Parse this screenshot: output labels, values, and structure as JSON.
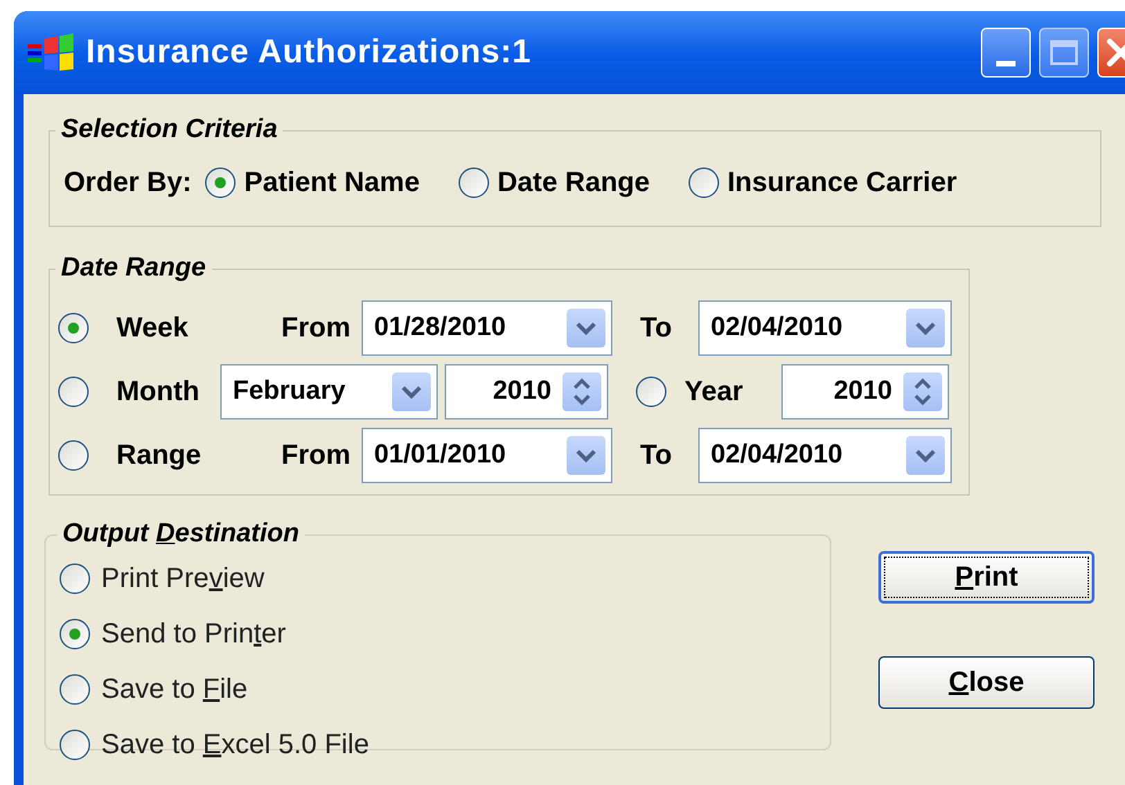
{
  "window": {
    "title": "Insurance Authorizations:1"
  },
  "selection_criteria": {
    "title": "Selection Criteria",
    "order_by_label": "Order By:",
    "options": [
      {
        "label": "Patient Name",
        "selected": true
      },
      {
        "label": "Date Range",
        "selected": false
      },
      {
        "label": "Insurance Carrier",
        "selected": false
      }
    ]
  },
  "date_range": {
    "title": "Date Range",
    "rows": [
      {
        "kind": "span",
        "label": "Week",
        "selected": true,
        "from_label": "From",
        "from": "01/28/2010",
        "to_label": "To",
        "to": "02/04/2010"
      },
      {
        "kind": "month",
        "label": "Month",
        "selected": false,
        "month": "February",
        "month_year": "2010",
        "year_option": {
          "label": "Year",
          "selected": false
        },
        "year": "2010"
      },
      {
        "kind": "span",
        "label": "Range",
        "selected": false,
        "from_label": "From",
        "from": "01/01/2010",
        "to_label": "To",
        "to": "02/04/2010"
      }
    ]
  },
  "output_destination": {
    "title": {
      "before": "Output ",
      "key": "D",
      "after": "estination"
    },
    "options": [
      {
        "label": {
          "before": "Print Pre",
          "key": "v",
          "after": "iew"
        },
        "selected": false
      },
      {
        "label": {
          "before": "Send to Prin",
          "key": "t",
          "after": "er"
        },
        "selected": true
      },
      {
        "label": {
          "before": "Save to ",
          "key": "F",
          "after": "ile"
        },
        "selected": false
      },
      {
        "label": {
          "before": "Save to ",
          "key": "E",
          "after": "xcel 5.0 File"
        },
        "selected": false
      }
    ]
  },
  "buttons": [
    {
      "label": {
        "key": "P",
        "after": "rint"
      },
      "focused": true
    },
    {
      "label": {
        "key": "C",
        "after": "lose"
      },
      "focused": false
    }
  ]
}
